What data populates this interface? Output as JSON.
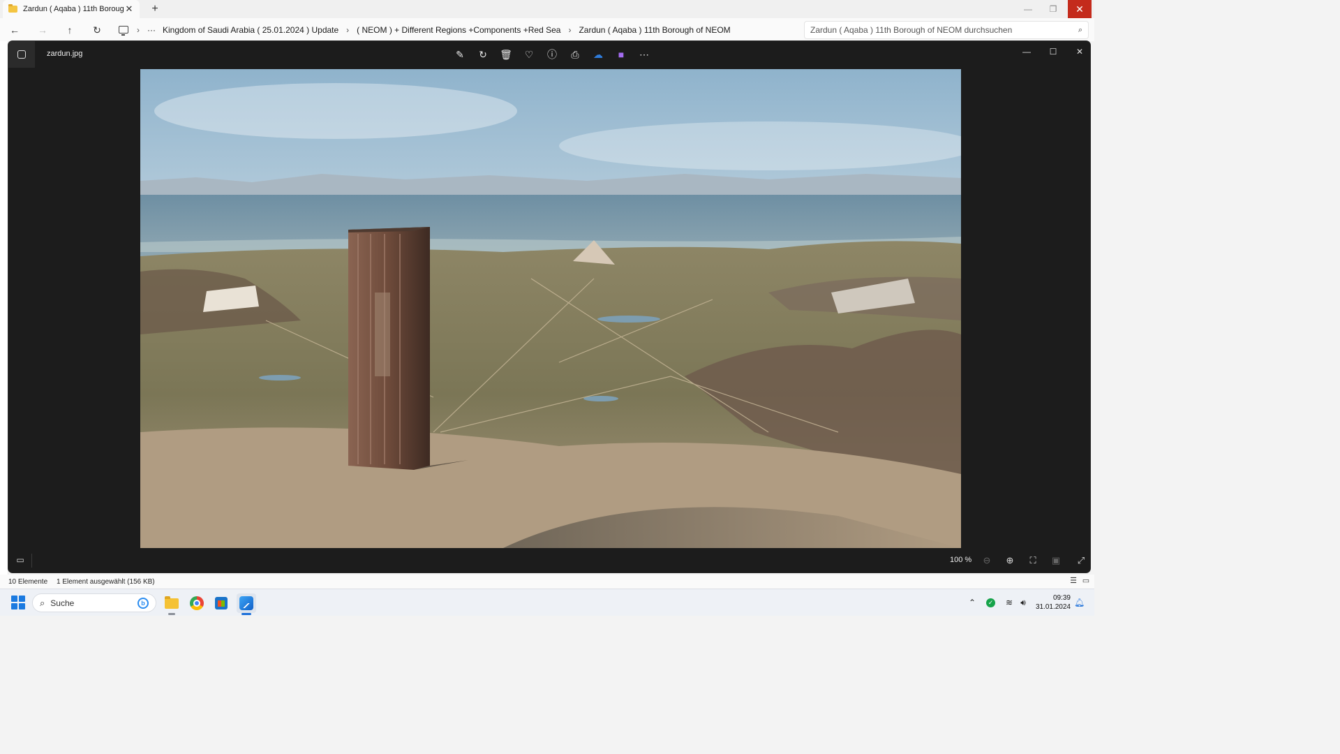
{
  "explorer": {
    "tab_title": "Zardun ( Aqaba )  11th Boroug",
    "tab_close": "✕",
    "new_tab": "+",
    "window_buttons": {
      "minimize": "—",
      "restore": "❐",
      "close": "✕"
    },
    "nav": {
      "back": "←",
      "forward": "→",
      "up": "↑",
      "refresh": "↻"
    },
    "breadcrumb": {
      "more": "···",
      "separator": "›",
      "items": [
        "Kingdom of Saudi Arabia ( 25.01.2024 ) Update",
        "( NEOM ) + Different Regions +Components +Red Sea",
        "Zardun ( Aqaba )  11th Borough of NEOM"
      ]
    },
    "search_placeholder": "Zardun ( Aqaba )  11th Borough of NEOM durchsuchen",
    "status": {
      "item_count": "10 Elemente",
      "selection": "1 Element ausgewählt (156 KB)"
    }
  },
  "viewer": {
    "filename": "zardun.jpg",
    "toolbar_icons": [
      "edit-icon",
      "rotate-icon",
      "delete-icon",
      "favorite-icon",
      "info-icon",
      "print-icon",
      "onedrive-icon",
      "clipchamp-icon",
      "more-icon"
    ],
    "zoom_label": "100 %",
    "photo_description_colors": {
      "sky_top": "#a9c3d6",
      "sea": "#5c7f93",
      "desert": "#9c8a6c",
      "tower": "#6e4a38"
    }
  },
  "taskbar": {
    "search_label": "Suche",
    "pinned_apps": [
      "file-explorer",
      "chrome",
      "microsoft-store",
      "photos"
    ],
    "time": "09:39",
    "date": "31.01.2024"
  }
}
